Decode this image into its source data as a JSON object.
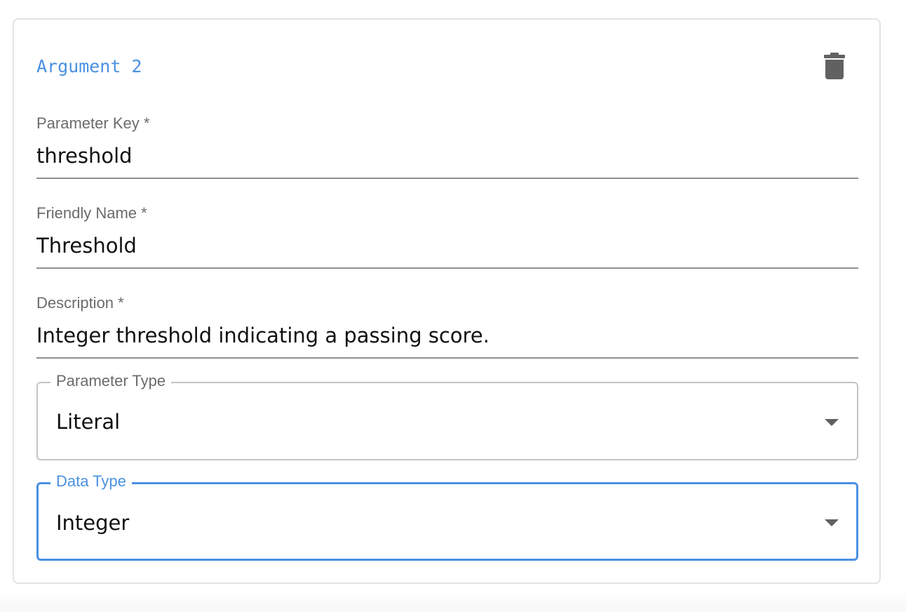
{
  "card": {
    "title": "Argument 2",
    "delete_icon": "trash-icon"
  },
  "fields": {
    "parameter_key": {
      "label": "Parameter Key *",
      "value": "threshold"
    },
    "friendly_name": {
      "label": "Friendly Name *",
      "value": "Threshold"
    },
    "description": {
      "label": "Description *",
      "value": "Integer threshold indicating a passing score."
    }
  },
  "selects": {
    "parameter_type": {
      "label": "Parameter Type",
      "value": "Literal",
      "icon": "chevron-down-icon"
    },
    "data_type": {
      "label": "Data Type",
      "value": "Integer",
      "icon": "chevron-down-icon",
      "focused": true
    }
  },
  "colors": {
    "accent": "#4a90e2",
    "label": "#6b6b6b",
    "text": "#111111",
    "icon": "#616161",
    "border": "#c4c4c4"
  }
}
